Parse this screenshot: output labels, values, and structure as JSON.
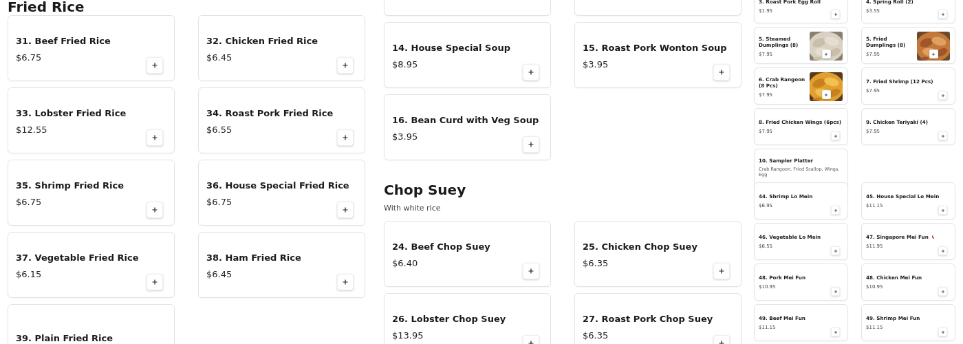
{
  "panels": [
    {
      "kind": "full",
      "sections": [
        {
          "heading": "Fried Rice",
          "items": [
            {
              "kind": "item",
              "name": "31. Beef Fried Rice",
              "price": "$6.75"
            },
            {
              "kind": "item",
              "name": "32. Chicken Fried Rice",
              "price": "$6.45"
            },
            {
              "kind": "item",
              "name": "33. Lobster Fried Rice",
              "price": "$12.55"
            },
            {
              "kind": "item",
              "name": "34. Roast Pork Fried Rice",
              "price": "$6.55"
            },
            {
              "kind": "item",
              "name": "35. Shrimp Fried Rice",
              "price": "$6.75"
            },
            {
              "kind": "item",
              "name": "36. House Special Fried Rice",
              "price": "$6.75"
            },
            {
              "kind": "item",
              "name": "37. Vegetable Fried Rice",
              "price": "$6.15"
            },
            {
              "kind": "item",
              "name": "38. Ham Fried Rice",
              "price": "$6.45"
            },
            {
              "kind": "item",
              "name": "39. Plain Fried Rice"
            }
          ]
        }
      ]
    },
    {
      "kind": "full",
      "sections": [
        {
          "items": [
            {
              "kind": "fragment"
            },
            {
              "kind": "fragment"
            },
            {
              "kind": "item",
              "name": "14. House Special Soup",
              "price": "$8.95"
            },
            {
              "kind": "item",
              "name": "15. Roast Pork Wonton Soup",
              "price": "$3.95"
            },
            {
              "kind": "item",
              "name": "16. Bean Curd with Veg Soup",
              "price": "$3.95"
            }
          ]
        },
        {
          "heading": "Chop Suey",
          "subtitle": "With white rice",
          "items": [
            {
              "kind": "item",
              "name": "24. Beef Chop Suey",
              "price": "$6.40"
            },
            {
              "kind": "item",
              "name": "25. Chicken Chop Suey",
              "price": "$6.35"
            },
            {
              "kind": "item",
              "name": "26. Lobster Chop Suey",
              "price": "$13.95"
            },
            {
              "kind": "item",
              "name": "27. Roast Pork Chop Suey",
              "price": "$6.35"
            }
          ]
        }
      ]
    },
    {
      "kind": "compact",
      "sections": [
        {
          "items": [
            {
              "kind": "item",
              "name": "3. Roast Pork Egg Roll",
              "price": "$1.95"
            },
            {
              "kind": "item",
              "name": "4. Spring Roll (2)",
              "price": "$3.55"
            },
            {
              "kind": "item",
              "name": "5. Steamed Dumplings (8)",
              "price": "$7.95",
              "photo": true
            },
            {
              "kind": "item",
              "name": "5. Fried Dumplings (8)",
              "price": "$7.95",
              "photo": true
            },
            {
              "kind": "item",
              "name": "6. Crab Rangoon (8 Pcs)",
              "price": "$7.95",
              "photo": true
            },
            {
              "kind": "item",
              "name": "7. Fried Shrimp (12 Pcs)",
              "price": "$7.95"
            },
            {
              "kind": "item",
              "name": "8. Fried Chicken Wings (6pcs)",
              "price": "$7.95"
            },
            {
              "kind": "item",
              "name": "9. Chicken Teriyaki (4)",
              "price": "$7.95"
            },
            {
              "kind": "item",
              "name": "10. Sampler Platter",
              "description": "Crab Rangoon, Fried Scallop, Wings, Egg"
            }
          ]
        },
        {
          "items": [
            {
              "kind": "item",
              "name": "44. Shrimp Lo Mein",
              "price": "$6.95"
            },
            {
              "kind": "item",
              "name": "45. House Special Lo Mein",
              "price": "$11.15"
            },
            {
              "kind": "item",
              "name": "46. Vegetable Lo Mein",
              "price": "$6.55"
            },
            {
              "kind": "item",
              "name": "47. Singapore Mei Fun",
              "price": "$11.95",
              "spicy": true
            },
            {
              "kind": "item",
              "name": "48. Pork Mei Fun",
              "price": "$10.95"
            },
            {
              "kind": "item",
              "name": "48. Chicken Mei Fun",
              "price": "$10.95"
            },
            {
              "kind": "item",
              "name": "49. Beef Mei Fun",
              "price": "$11.15"
            },
            {
              "kind": "item",
              "name": "49. Shrimp Mei Fun",
              "price": "$11.15"
            }
          ]
        }
      ]
    }
  ]
}
